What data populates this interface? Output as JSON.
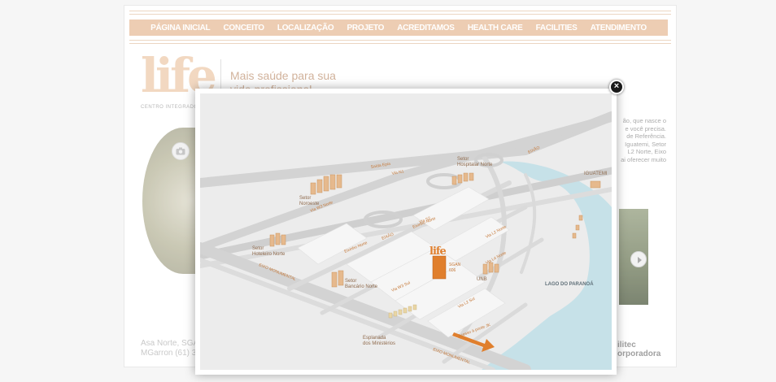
{
  "nav": {
    "items": [
      "PÁGINA INICIAL",
      "CONCEITO",
      "LOCALIZAÇÃO",
      "PROJETO",
      "ACREDITAMOS",
      "HEALTH CARE",
      "FACILITIES",
      "ATENDIMENTO"
    ]
  },
  "header": {
    "logo": "life",
    "logo_sub": "CENTRO INTEGRADO",
    "slogan_line1": "Mais saúde para sua",
    "slogan_line2": "vida profissional"
  },
  "content": {
    "body_text_lines": [
      "ão, que nasce o",
      "e você precisa.",
      "de Referência.",
      "Iguatemi, Setor",
      "L2 Norte, Eixo",
      "ai oferecer muito"
    ],
    "address_line1": "Asa Norte, SGA",
    "address_line2": "MGarron (61) 3",
    "brand_line1": "ilitec",
    "brand_line2": "orporadora"
  },
  "map": {
    "labels": {
      "eixo_top": "EIXÃO",
      "setor_noroeste_1": "Setor",
      "setor_noroeste_2": "Noroeste",
      "setor_hospitalar_1": "Setor",
      "setor_hospitalar_2": "Hospitalar Norte",
      "iguatemi": "IGUATEMI",
      "setor_hoteleiro_1": "Setor",
      "setor_hoteleiro_2": "Hoteleiro Norte",
      "setor_bancario_1": "Setor",
      "setor_bancario_2": "Bancário Norte",
      "life_logo": "life",
      "sgan_1": "SGAN",
      "sgan_2": "606",
      "unb": "UNB",
      "lago": "LAGO DO PARANOÁ",
      "esplanada_1": "Esplanada",
      "esplanada_2": "dos Ministérios",
      "eixo_monumental_1": "EIXO MONUMENTAL",
      "eixo_monumental_2": "EIXO MONUMENTAL",
      "acesso": "Acesso à ponte JK",
      "eixao_mid": "EIXÃO",
      "l2_norte": "Via L2 Norte",
      "l4_norte": "Via L4 Norte",
      "w3_norte": "Via W3 Norte",
      "w3_sul": "Via W3 Sul",
      "eixinho": "Eixinho Norte",
      "eixinho2": "Eixinho Norte",
      "s2": "Via S2",
      "n1": "Via N1",
      "l2_sul": "Via L2 Sul",
      "eptg": "Saída Epia"
    }
  },
  "lightbox": {
    "close_label": "×"
  },
  "colors": {
    "accent": "#e9c3a3",
    "label": "#c57838",
    "water": "#c6e1e8",
    "road": "#d0d0d0"
  }
}
